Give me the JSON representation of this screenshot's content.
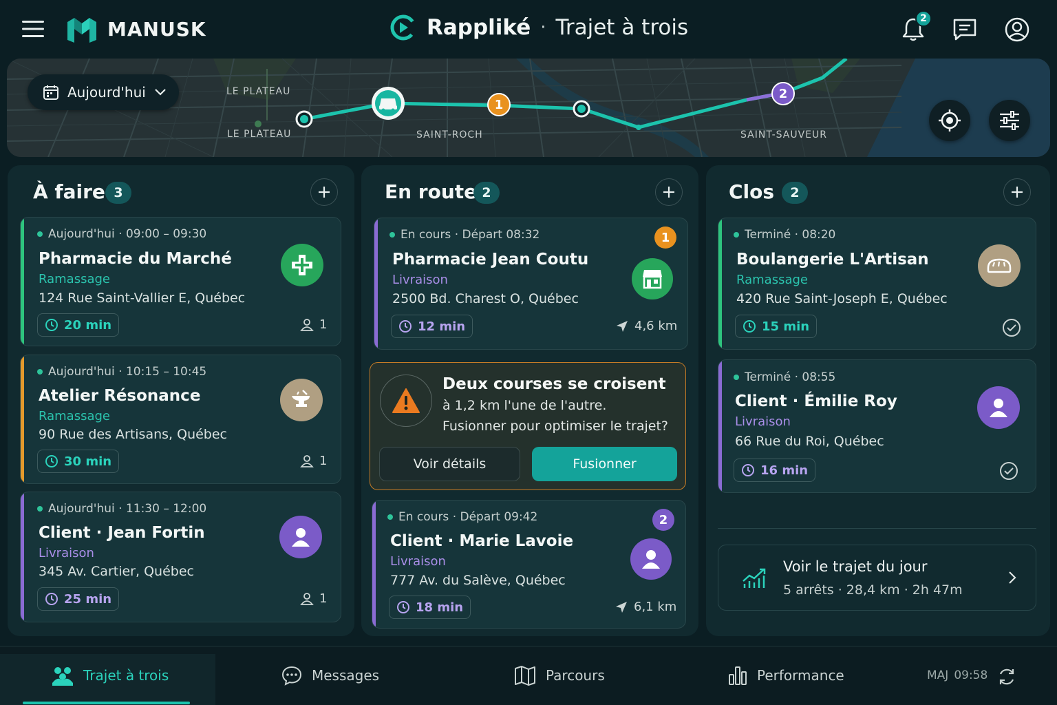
{
  "header": {
    "brand": "MANUSK",
    "app_name": "Rappliké",
    "separator": "·",
    "subtitle": "Trajet à trois",
    "notification_count": "2"
  },
  "map": {
    "date_label": "Aujourd'hui",
    "labels": [
      "LE PLATEAU",
      "LE PLATEAU",
      "SAINT-ROCH",
      "SAINT-SAUVEUR"
    ],
    "markers": [
      "1",
      "2"
    ]
  },
  "columns": [
    {
      "title": "À faire",
      "count": "3",
      "cards": [
        {
          "status": "Aujourd'hui · 09:00 – 09:30",
          "name": "Pharmacie du Marché",
          "type": "Ramassage",
          "address": "124 Rue Saint-Vallier E, Québec",
          "duration": "20 min",
          "people": "1",
          "accent": "#2ec47e",
          "icon": "pharmacy-cross-icon"
        },
        {
          "status": "Aujourd'hui · 10:15 – 10:45",
          "name": "Atelier Résonance",
          "type": "Ramassage",
          "address": "90 Rue des Artisans, Québec",
          "duration": "30 min",
          "people": "1",
          "accent": "#e49a2c",
          "icon": "anvil-icon"
        },
        {
          "status": "Aujourd'hui · 11:30 – 12:00",
          "name": "Client · Jean Fortin",
          "type": "Livraison",
          "address": "345 Av. Cartier, Québec",
          "duration": "25 min",
          "people": "1",
          "accent": "#8a6bd3",
          "icon": "user-icon"
        }
      ]
    },
    {
      "title": "En route",
      "count": "2",
      "cards": [
        {
          "status": "En cours · Départ 08:32",
          "name": "Pharmacie Jean Coutu",
          "type": "Livraison",
          "address": "2500 Bd. Charest O, Québec",
          "duration": "12 min",
          "distance": "4,6 km",
          "badge": "1",
          "accent": "#8a6bd3",
          "icon": "storefront-icon"
        },
        {
          "status": "En cours · Départ 09:42",
          "name": "Client · Marie Lavoie",
          "type": "Livraison",
          "address": "777 Av. du Salève, Québec",
          "duration": "18 min",
          "distance": "6,1 km",
          "badge": "2",
          "accent": "#8a6bd3",
          "icon": "user-icon"
        }
      ],
      "alert": {
        "title": "Deux courses se croisent",
        "line1": "à 1,2 km l'une de l'autre.",
        "line2": "Fusionner pour optimiser le trajet?",
        "secondary": "Voir détails",
        "primary": "Fusionner"
      }
    },
    {
      "title": "Clos",
      "count": "2",
      "cards": [
        {
          "status": "Terminé · 08:20",
          "name": "Boulangerie L'Artisan",
          "type": "Ramassage",
          "address": "420 Rue Saint-Joseph E, Québec",
          "duration": "15 min",
          "accent": "#2ec47e",
          "icon": "bread-icon"
        },
        {
          "status": "Terminé · 08:55",
          "name": "Client · Émilie Roy",
          "type": "Livraison",
          "address": "66 Rue du Roi, Québec",
          "duration": "16 min",
          "accent": "#8a6bd3",
          "icon": "user-icon"
        }
      ],
      "summary": {
        "title": "Voir le trajet du jour",
        "detail": "5 arrêts · 28,4 km · 2h 47m"
      }
    }
  ],
  "nav": {
    "items": [
      "Trajet à trois",
      "Messages",
      "Parcours",
      "Performance"
    ],
    "update_label": "MAJ",
    "update_time": "09:58"
  }
}
